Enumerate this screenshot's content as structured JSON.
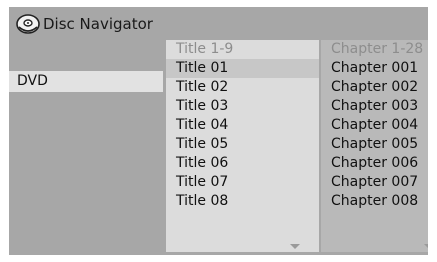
{
  "window": {
    "title": "Disc Navigator",
    "icon": "disc-icon"
  },
  "source": {
    "label": "DVD"
  },
  "titles": {
    "header": "Title 1-9",
    "items": [
      "Title 01",
      "Title 02",
      "Title 03",
      "Title 04",
      "Title 05",
      "Title 06",
      "Title 07",
      "Title 08"
    ],
    "selected": "Title 01"
  },
  "chapters": {
    "header": "Chapter 1-28",
    "items": [
      "Chapter 001",
      "Chapter 002",
      "Chapter 003",
      "Chapter 004",
      "Chapter 005",
      "Chapter 006",
      "Chapter 007",
      "Chapter 008"
    ]
  },
  "colors": {
    "screen_background": "#a7a7a7",
    "list_panel": "#dcdcdc",
    "chapter_panel": "#b9b9b9",
    "selected_row": "#c7c7c7",
    "header_text": "#8d8d8d"
  }
}
